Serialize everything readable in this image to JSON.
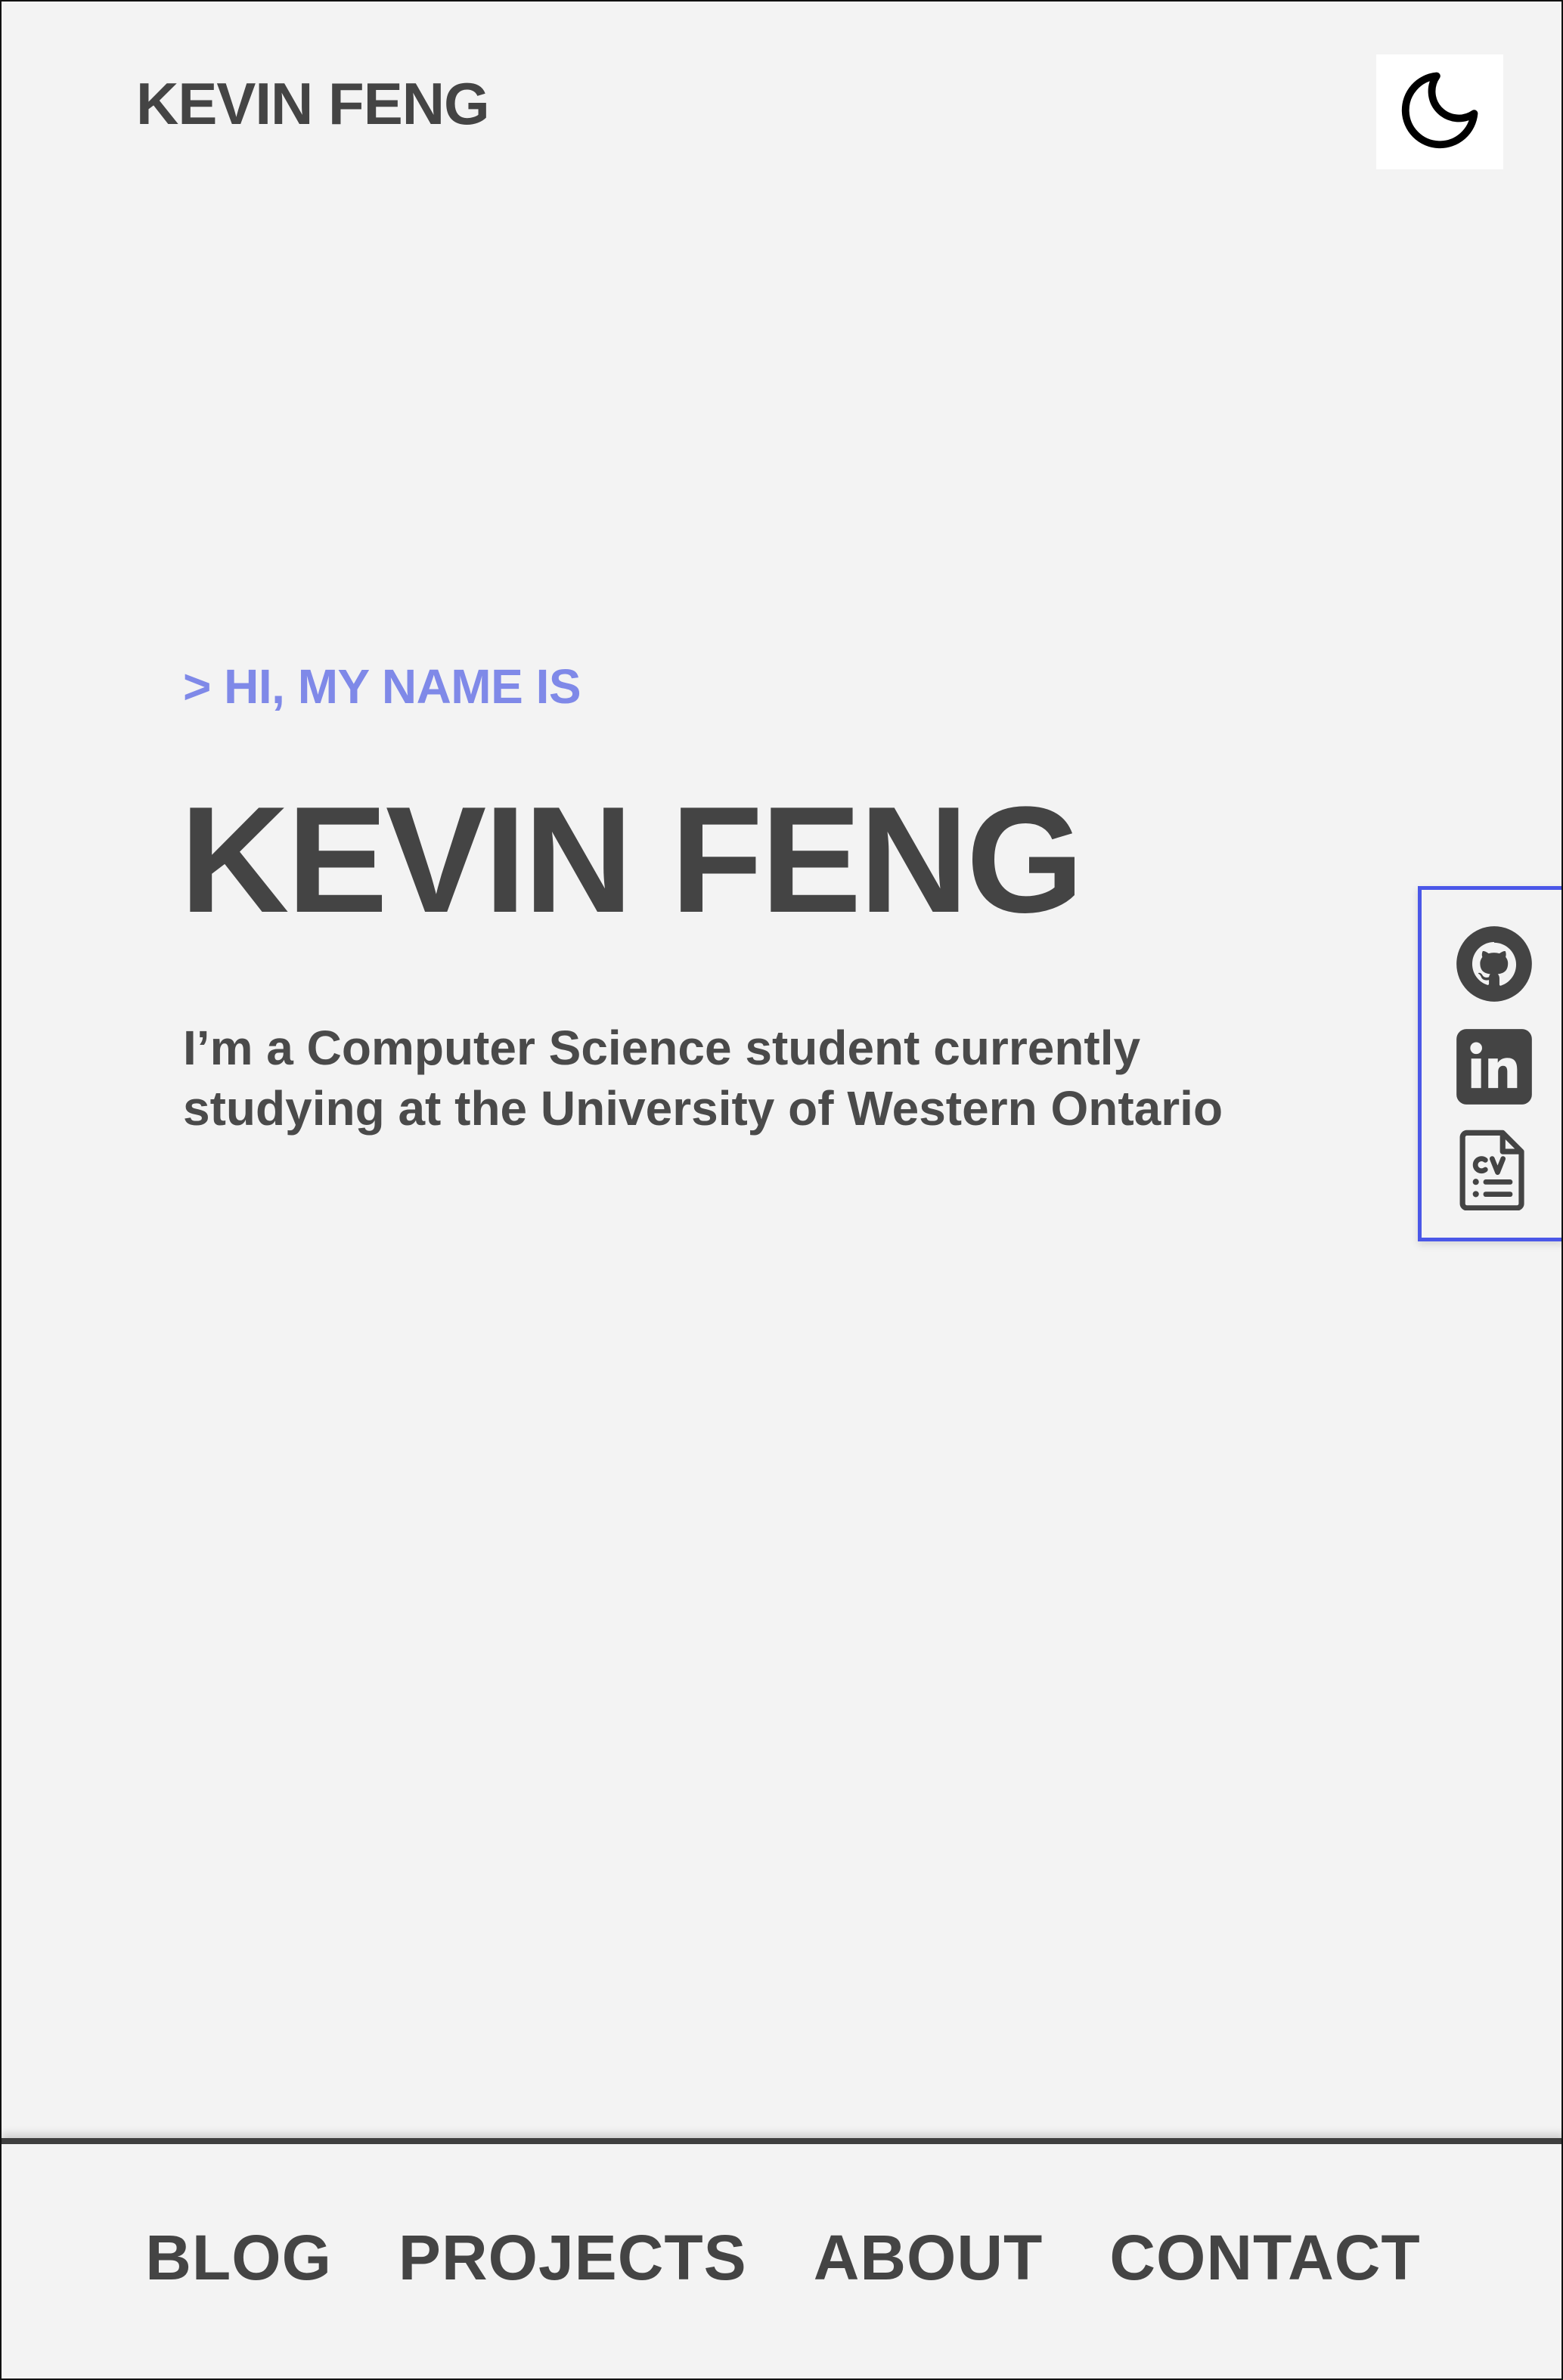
{
  "header": {
    "brand": "KEVIN FENG",
    "theme_toggle_icon": "moon-icon"
  },
  "hero": {
    "kicker": "> HI, MY NAME IS",
    "name": "KEVIN FENG",
    "description": "I’m a Computer Science student currently studying at the University of Western Ontario"
  },
  "social": {
    "accent_color": "#4a57e8",
    "items": [
      {
        "icon": "github-icon"
      },
      {
        "icon": "linkedin-icon"
      },
      {
        "icon": "cv-document-icon"
      }
    ]
  },
  "nav": {
    "items": [
      {
        "label": "BLOG"
      },
      {
        "label": "PROJECTS"
      },
      {
        "label": "ABOUT"
      },
      {
        "label": "CONTACT"
      }
    ]
  },
  "colors": {
    "background": "#f3f3f3",
    "text": "#444444",
    "kicker": "#7f89e8"
  }
}
